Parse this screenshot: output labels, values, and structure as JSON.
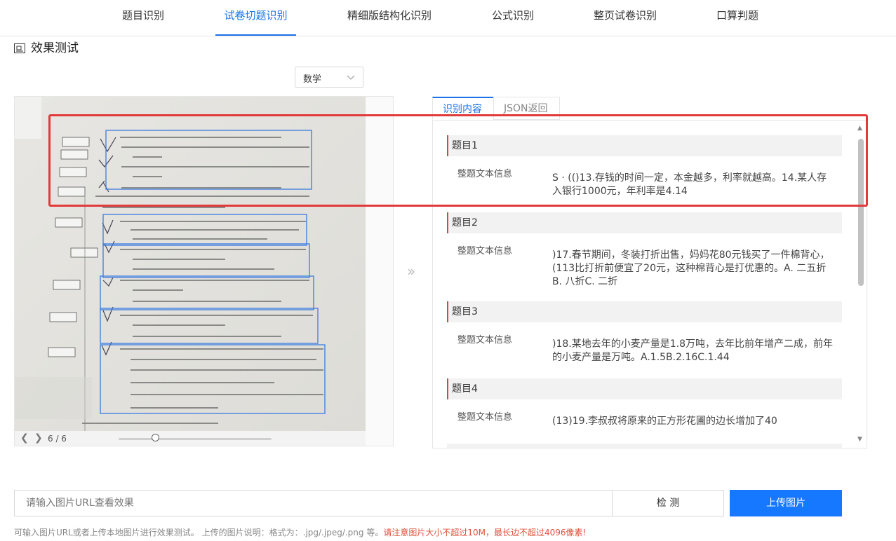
{
  "nav": {
    "tabs": [
      {
        "label": "题目识别"
      },
      {
        "label": "试卷切题识别"
      },
      {
        "label": "精细版结构化识别"
      },
      {
        "label": "公式识别"
      },
      {
        "label": "整页试卷识别"
      },
      {
        "label": "口算判题"
      }
    ],
    "active_index": 1
  },
  "section_title": "效果测试",
  "subject_select": {
    "value": "数学"
  },
  "viewer": {
    "page_counter": "6 / 6",
    "slider_position": 0.25
  },
  "result_tabs": [
    {
      "label": "识别内容"
    },
    {
      "label": "JSON返回"
    }
  ],
  "questions": [
    {
      "title": "题目1",
      "label": "整题文本信息",
      "text": "S · (()13.存钱的时间一定，本金越多，利率就越高。14.某人存入银行1000元，年利率是4.14"
    },
    {
      "title": "题目2",
      "label": "整题文本信息",
      "text": ")17.春节期间，冬装打折出售，妈妈花80元钱买了一件棉背心，(113比打折前便宜了20元，这种棉背心是打优惠的。A. 二五折B. 八折C. 二折"
    },
    {
      "title": "题目3",
      "label": "整题文本信息",
      "text": ")18.某地去年的小麦产量是1.8万吨，去年比前年增产二成，前年的小麦产量是万吨。A.1.5B.2.16C.1.44"
    },
    {
      "title": "题目4",
      "label": "整题文本信息",
      "text": "(13)19.李叔叔将原来的正方形花圃的边长增加了40"
    }
  ],
  "bottom": {
    "url_placeholder": "请输入图片URL查看效果",
    "detect_label": "检 测",
    "upload_label": "上传图片",
    "hint_text": "可输入图片URL或者上传本地图片进行效果测试。 上传的图片说明：格式为：.jpg/.jpeg/.png 等。",
    "hint_warning": "请注意图片大小不超过10M，最长边不超过4096像素!"
  },
  "colors": {
    "accent": "#1677ff",
    "highlight_box": "#e23a3a"
  }
}
